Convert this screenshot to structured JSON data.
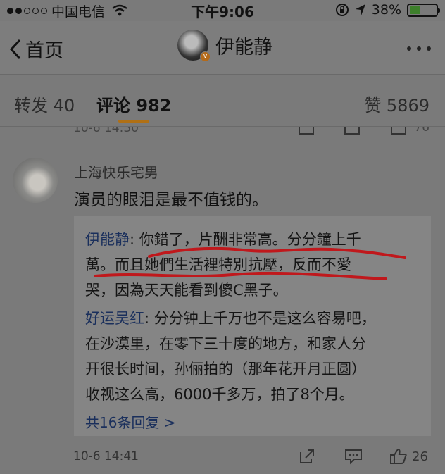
{
  "status_bar": {
    "carrier": "中国电信",
    "time": "下午9:06",
    "battery": "38%",
    "battery_level": 0.38
  },
  "nav": {
    "back_label": "首页",
    "title": "伊能静"
  },
  "tabs": {
    "repost": "转发 40",
    "comment": "评论 982",
    "like": "赞 5869"
  },
  "previous_row": {
    "time": "10-6 14:30",
    "like_count": "76"
  },
  "comment": {
    "user": "上海快乐宅男",
    "text": "演员的眼泪是最不值钱的。",
    "replies": [
      {
        "name": "伊能静",
        "lines": [
          "伊能静: 你錯了，片酬非常高。分分鐘上千",
          "萬。而且她們生活裡特別抗壓，反而不愛",
          "哭，因為天天能看到傻C黑子。"
        ]
      },
      {
        "name": "好运吴红",
        "lines": [
          "好运吴红: 分分钟上千万也不是这么容易吧，",
          "在沙漠里，在零下三十度的地方，和家人分",
          "开很长时间，孙俪拍的（那年花开月正圆）",
          "收视这么高，6000千多万，拍了8个月。"
        ]
      }
    ],
    "more_replies": "共16条回复 >",
    "time": "10-6 14:41",
    "like_count": "26"
  },
  "colors": {
    "accent": "#b07015",
    "link": "#1a2f5c",
    "scribble": "#c0181c"
  }
}
